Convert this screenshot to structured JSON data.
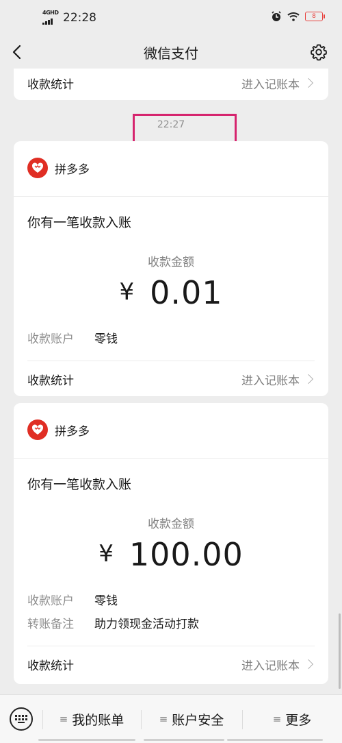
{
  "status": {
    "network": "4GHD",
    "time": "22:28",
    "battery": "8"
  },
  "header": {
    "title": "微信支付"
  },
  "stats_label": "收款统计",
  "ledger_link": "进入记账本",
  "timestamp": "22:27",
  "messages": [
    {
      "merchant": "拼多多",
      "notice": "你有一笔收款入账",
      "amount_label": "收款金额",
      "currency": "¥",
      "amount": "0.01",
      "account_key": "收款账户",
      "account_value": "零钱"
    },
    {
      "merchant": "拼多多",
      "notice": "你有一笔收款入账",
      "amount_label": "收款金额",
      "currency": "¥",
      "amount": "100.00",
      "account_key": "收款账户",
      "account_value": "零钱",
      "remark_key": "转账备注",
      "remark_value": "助力领现金活动打款"
    }
  ],
  "bottom_menu": [
    "我的账单",
    "账户安全",
    "更多"
  ],
  "colors": {
    "highlight": "#d6246e",
    "brand_red": "#e02e24",
    "battery": "#e8433f"
  }
}
